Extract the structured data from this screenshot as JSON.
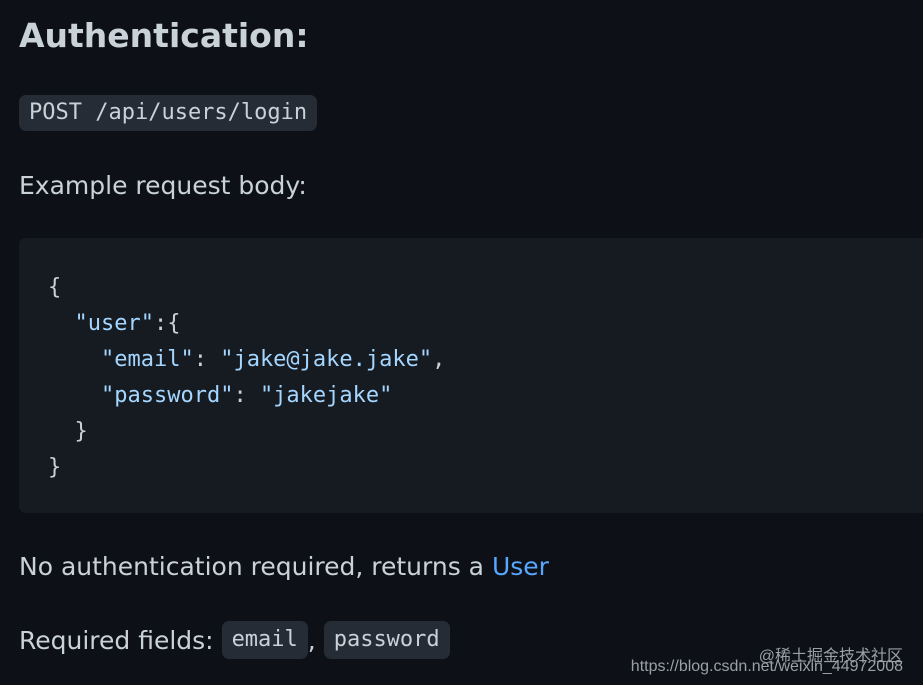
{
  "heading": "Authentication:",
  "endpoint": "POST /api/users/login",
  "example_label": "Example request body:",
  "code": {
    "open_brace": "{",
    "user_key": "\"user\"",
    "user_sep": ":{",
    "email_key": "\"email\"",
    "email_sep": ": ",
    "email_value": "\"jake@jake.jake\"",
    "email_comma": ",",
    "password_key": "\"password\"",
    "password_sep": ": ",
    "password_value": "\"jakejake\"",
    "inner_close": "}",
    "outer_close": "}"
  },
  "auth_note": {
    "text": "No authentication required, returns a ",
    "link": "User"
  },
  "required": {
    "label": "Required fields: ",
    "fields": [
      "email",
      "password"
    ],
    "separator": ", "
  },
  "watermark": {
    "line1": "@稀土掘金技术社区",
    "line2": "https://blog.csdn.net/weixin_44972008"
  },
  "colors": {
    "background": "#0d1117",
    "text": "#c9d1d9",
    "code_background": "#161b22",
    "inline_code_background": "#262c36",
    "string": "#a5d6ff",
    "link": "#58a6ff"
  }
}
